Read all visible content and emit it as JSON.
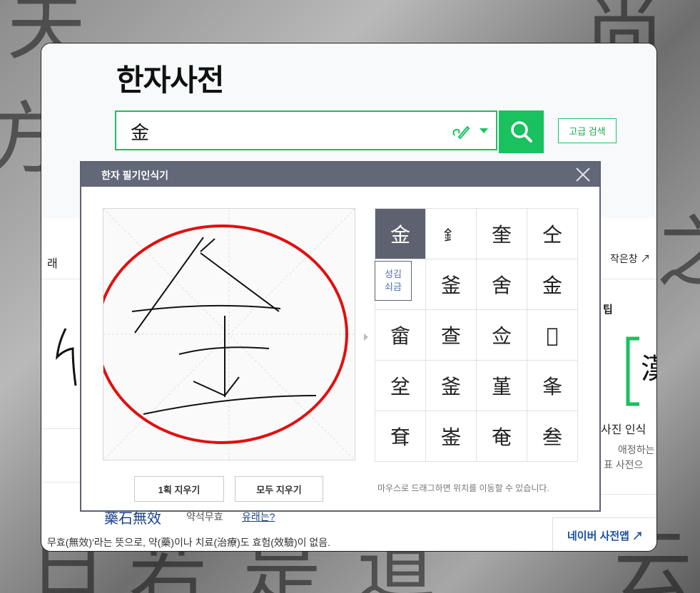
{
  "page_title": "한자사전",
  "search": {
    "value": "金"
  },
  "advanced_search_label": "고급 검색",
  "side_labels": {
    "left_tab": "래",
    "small_window": "작은창 ↗",
    "tip": "팁",
    "photo_recognition": "사진 인식",
    "favorite": "애정하는",
    "dict_label": "표 사전으",
    "app_link": "네이버 사전앱 ↗"
  },
  "example": {
    "idiom": "藥石無效",
    "reading": "약석무효",
    "question": "유래는?",
    "meaning": "무효(無效)'라는 뜻으로, 약(藥)이나 치료(治療)도 효험(效驗)이 없음."
  },
  "popup": {
    "title": "한자 필기인식기",
    "candidates": [
      "金",
      "釒",
      "奎",
      "仝",
      "",
      "釜",
      "舍",
      "金",
      "畲",
      "查",
      "佥",
      "𠅨",
      "坌",
      "釜",
      "堇",
      "夆",
      "耷",
      "崟",
      "奄",
      "叁"
    ],
    "reading_badge": [
      "성김",
      "쇠금"
    ],
    "clear_one_label": "1획 지우기",
    "clear_all_label": "모두 지우기",
    "hint": "마우스로 드래그하면 위치를 이동할 수 있습니다."
  },
  "colors": {
    "accent": "#19c15f",
    "popup_header": "#636878",
    "circle": "#e01010"
  }
}
